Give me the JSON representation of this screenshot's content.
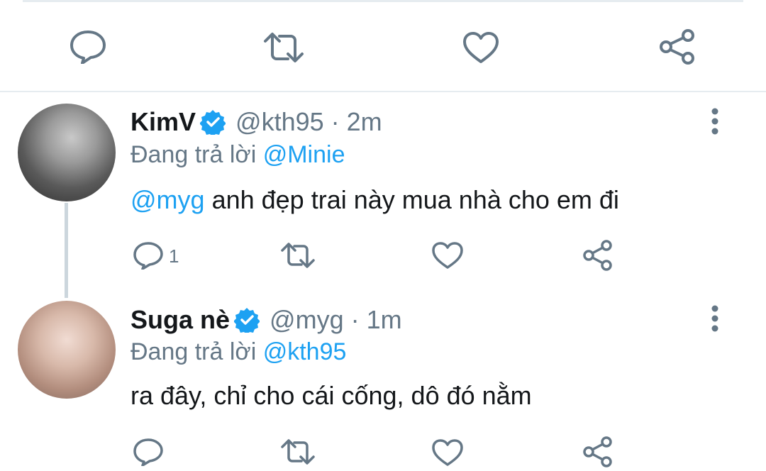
{
  "colors": {
    "accent": "#1da1f2",
    "secondary_text": "#657786",
    "primary_text": "#14171a",
    "divider": "#e6ecf0",
    "thread_line": "#ccd6dd"
  },
  "top_actions": {
    "icons": [
      "reply-icon",
      "retweet-icon",
      "like-icon",
      "share-icon"
    ]
  },
  "tweets": [
    {
      "name": "KimV",
      "verified": true,
      "handle": "@kth95",
      "separator": "·",
      "time": "2m",
      "reply_prefix": "Đang trả lời",
      "reply_to": "@Minie",
      "mention": "@myg",
      "text": " anh đẹp trai này mua nhà cho em đi",
      "reply_count": "1"
    },
    {
      "name": "Suga nè",
      "verified": true,
      "handle": "@myg",
      "separator": "·",
      "time": "1m",
      "reply_prefix": "Đang trả lời",
      "reply_to": "@kth95",
      "text": "ra đây, chỉ cho cái cống, dô đó nằm"
    }
  ]
}
